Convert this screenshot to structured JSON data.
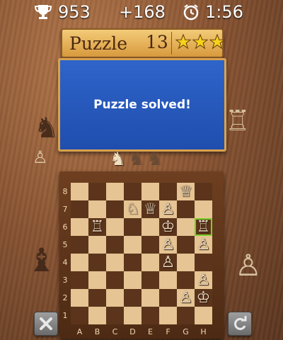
{
  "topbar": {
    "trophy_icon": "trophy-icon",
    "score": "953",
    "bonus": "+168",
    "clock_icon": "clock-icon",
    "time": "1:56"
  },
  "banner": {
    "title": "Puzzle",
    "number": "13",
    "stars": 3
  },
  "panel": {
    "message": "Puzzle solved!"
  },
  "hint_knights": [
    "knight-active",
    "knight-empty",
    "knight-empty"
  ],
  "board": {
    "files": [
      "A",
      "B",
      "C",
      "D",
      "E",
      "F",
      "G",
      "H"
    ],
    "ranks": [
      "8",
      "7",
      "6",
      "5",
      "4",
      "3",
      "2",
      "1"
    ],
    "highlight": "h6",
    "pieces": [
      {
        "square": "g8",
        "glyph": "♕",
        "name": "queen"
      },
      {
        "square": "d7",
        "glyph": "♘",
        "name": "knight"
      },
      {
        "square": "e7",
        "glyph": "♕",
        "name": "queen"
      },
      {
        "square": "f7",
        "glyph": "♙",
        "name": "pawn"
      },
      {
        "square": "b6",
        "glyph": "♖",
        "name": "rook"
      },
      {
        "square": "f6",
        "glyph": "♔",
        "name": "king"
      },
      {
        "square": "h6",
        "glyph": "♖",
        "name": "rook"
      },
      {
        "square": "f5",
        "glyph": "♙",
        "name": "pawn"
      },
      {
        "square": "h5",
        "glyph": "♙",
        "name": "pawn"
      },
      {
        "square": "f4",
        "glyph": "♙",
        "name": "pawn"
      },
      {
        "square": "h3",
        "glyph": "♙",
        "name": "pawn"
      },
      {
        "square": "g2",
        "glyph": "♙",
        "name": "pawn"
      },
      {
        "square": "h2",
        "glyph": "♔",
        "name": "king"
      }
    ]
  },
  "buttons": {
    "close_icon": "close-icon",
    "undo_icon": "undo-icon"
  }
}
